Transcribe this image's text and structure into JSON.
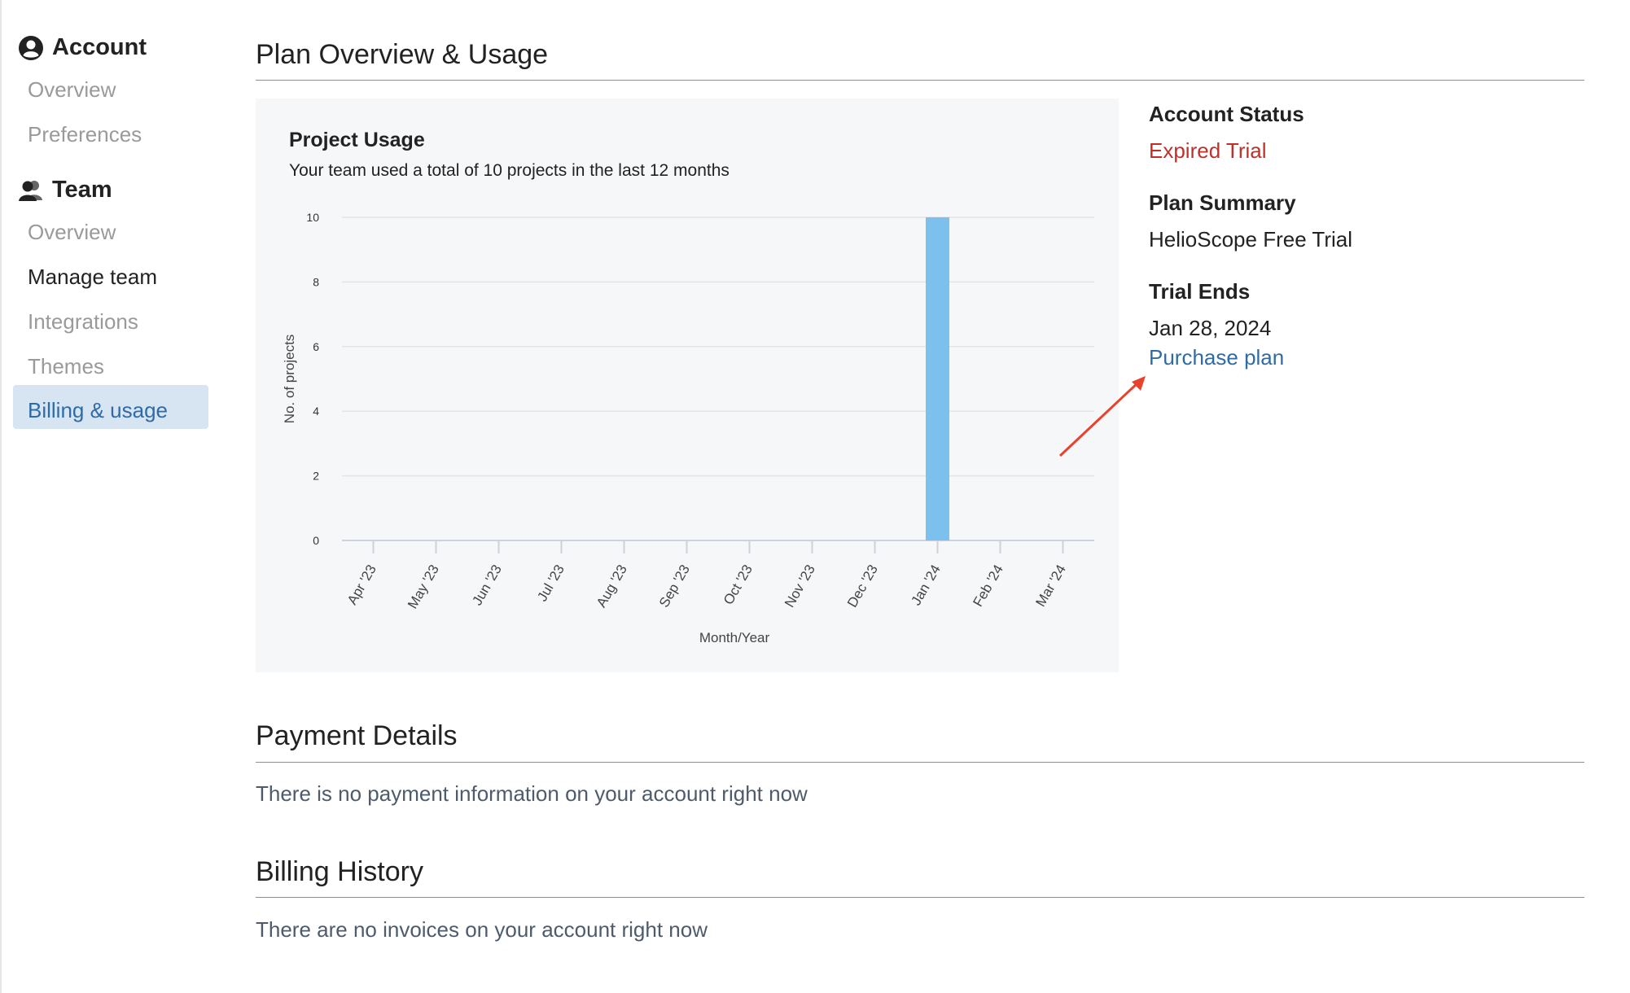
{
  "sidebar": {
    "account": {
      "title": "Account",
      "items": [
        "Overview",
        "Preferences"
      ]
    },
    "team": {
      "title": "Team",
      "items": [
        "Overview",
        "Manage team",
        "Integrations",
        "Themes",
        "Billing & usage"
      ],
      "active_index": 4
    }
  },
  "plan": {
    "heading": "Plan Overview & Usage",
    "account_status_label": "Account Status",
    "account_status_value": "Expired Trial",
    "plan_summary_label": "Plan Summary",
    "plan_summary_value": "HelioScope Free Trial",
    "trial_ends_label": "Trial Ends",
    "trial_ends_value": "Jan 28, 2024",
    "purchase_link": "Purchase plan"
  },
  "usage": {
    "title": "Project Usage",
    "subtitle": "Your team used a total of 10 projects in the last 12 months"
  },
  "chart_data": {
    "type": "bar",
    "title": "Project Usage",
    "subtitle": "Your team used a total of 10 projects in the last 12 months",
    "xlabel": "Month/Year",
    "ylabel": "No. of projects",
    "categories": [
      "Apr '23",
      "May '23",
      "Jun '23",
      "Jul '23",
      "Aug '23",
      "Sep '23",
      "Oct '23",
      "Nov '23",
      "Dec '23",
      "Jan '24",
      "Feb '24",
      "Mar '24"
    ],
    "values": [
      0,
      0,
      0,
      0,
      0,
      0,
      0,
      0,
      0,
      10,
      0,
      0
    ],
    "ylim": [
      0,
      10
    ],
    "yticks": [
      0,
      2,
      4,
      6,
      8,
      10
    ],
    "grid": true,
    "bar_color": "#7cc1ee"
  },
  "payment": {
    "heading": "Payment Details",
    "text": "There is no payment information on your account right now"
  },
  "billing": {
    "heading": "Billing History",
    "text": "There are no invoices on your account right now"
  },
  "colors": {
    "accent": "#2f6ba6",
    "active_bg": "#d7e5f2",
    "expired": "#c0302b",
    "annotation_arrow": "#e8412c"
  }
}
